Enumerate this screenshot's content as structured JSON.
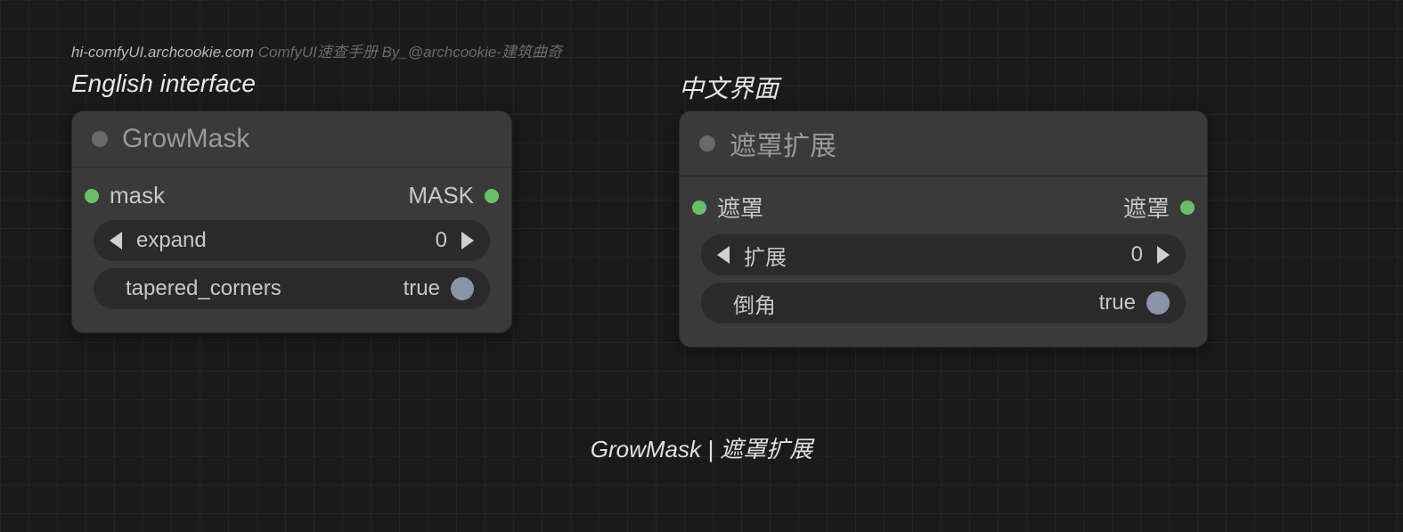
{
  "attribution": {
    "site": "hi-comfyUI.archcookie.com",
    "byline": " ComfyUI速查手册 By_@archcookie-建筑曲奇"
  },
  "headings": {
    "left": "English interface",
    "right": "中文界面"
  },
  "nodes": {
    "en": {
      "title": "GrowMask",
      "input_label": "mask",
      "output_label": "MASK",
      "widgets": {
        "expand": {
          "label": "expand",
          "value": "0"
        },
        "tapered": {
          "label": "tapered_corners",
          "value": "true"
        }
      }
    },
    "zh": {
      "title": "遮罩扩展",
      "input_label": "遮罩",
      "output_label": "遮罩",
      "widgets": {
        "expand": {
          "label": "扩展",
          "value": "0"
        },
        "tapered": {
          "label": "倒角",
          "value": "true"
        }
      }
    }
  },
  "caption": "GrowMask | 遮罩扩展"
}
